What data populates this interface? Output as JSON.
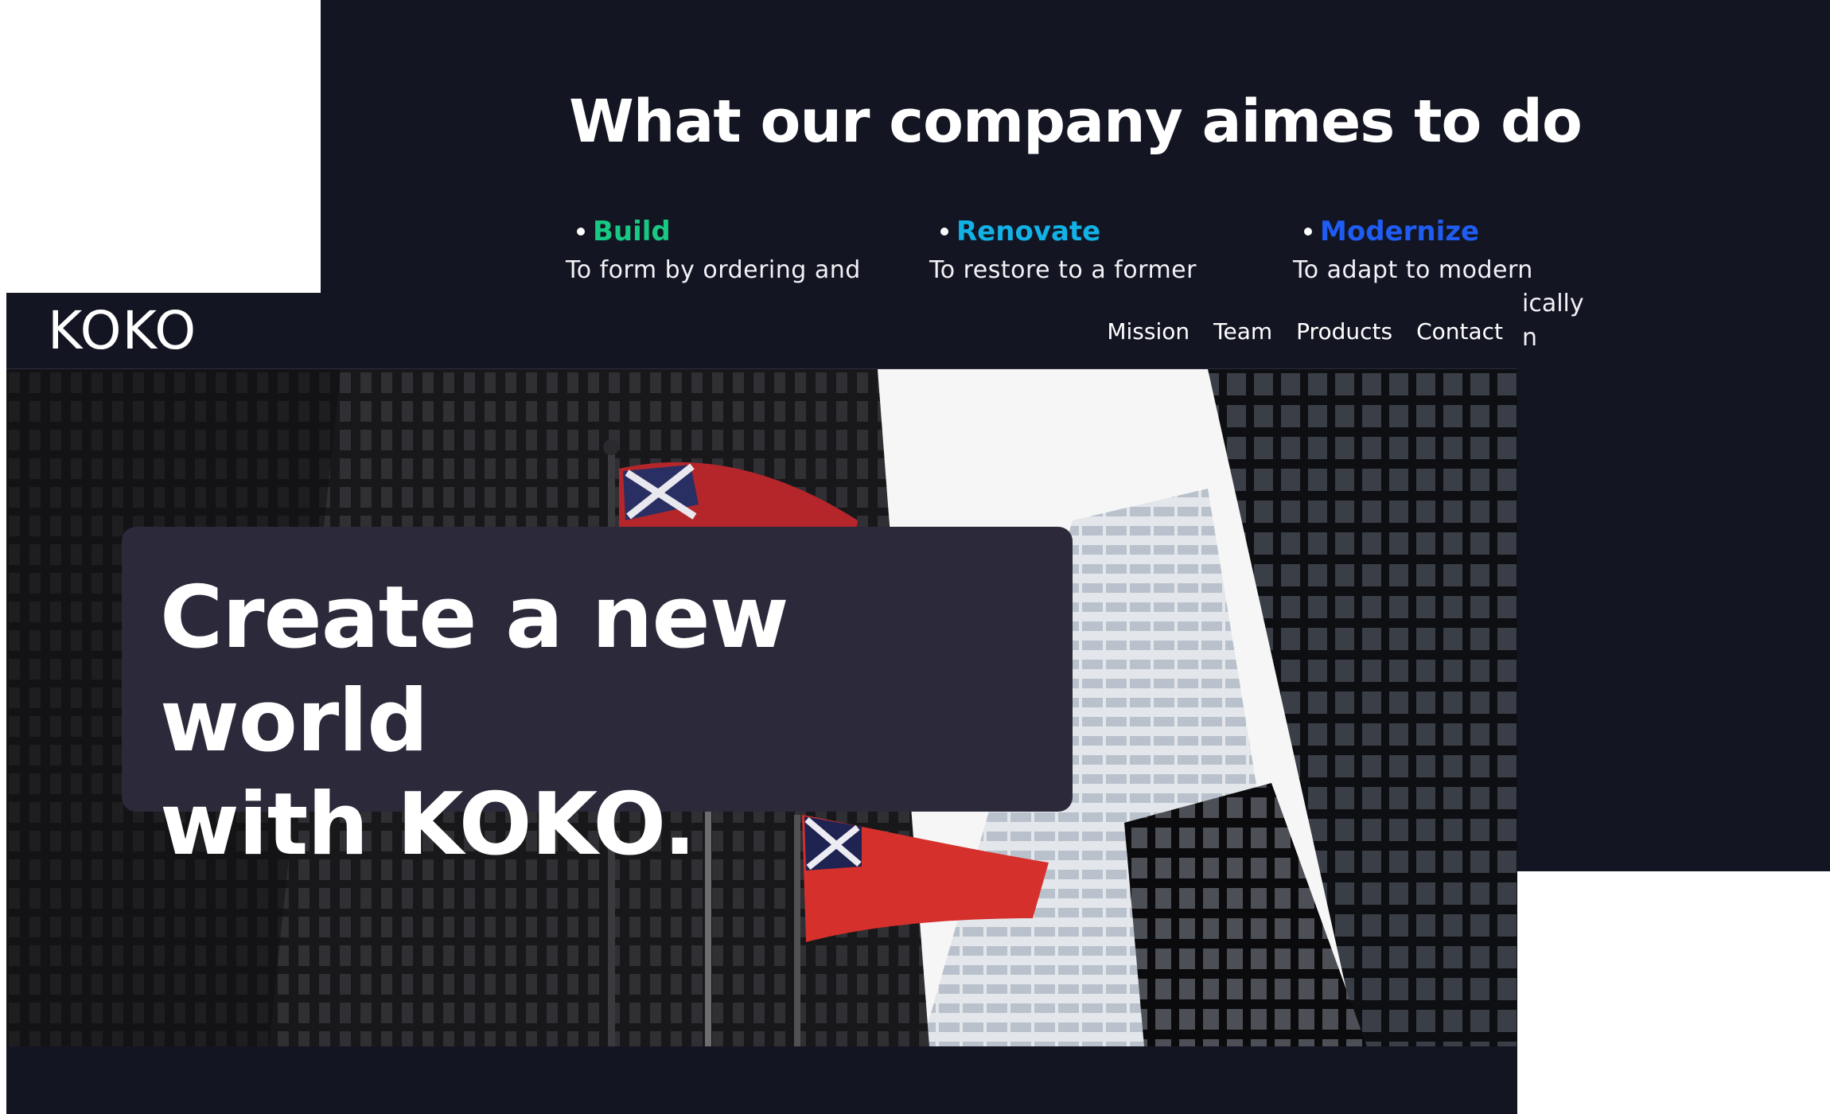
{
  "mission": {
    "title": "What our company aimes to do",
    "aims": [
      {
        "label": "Build",
        "color": "#17c982",
        "text": "To form by ordering and"
      },
      {
        "label": "Renovate",
        "color": "#12b1e6",
        "text": "To restore to a former"
      },
      {
        "label": "Modernize",
        "color": "#1f5cf2",
        "text": "To adapt to modern"
      }
    ],
    "overflow_fragments": [
      "ically",
      "n"
    ]
  },
  "navbar": {
    "logo": "KOKO",
    "links": [
      "Mission",
      "Team",
      "Products",
      "Contact"
    ]
  },
  "hero": {
    "heading_line1": "Create a new world",
    "heading_line2": "with KOKO."
  },
  "colors": {
    "page_bg": "#131522",
    "hero_card_bg": "#2b293a",
    "text": "#ffffff"
  }
}
